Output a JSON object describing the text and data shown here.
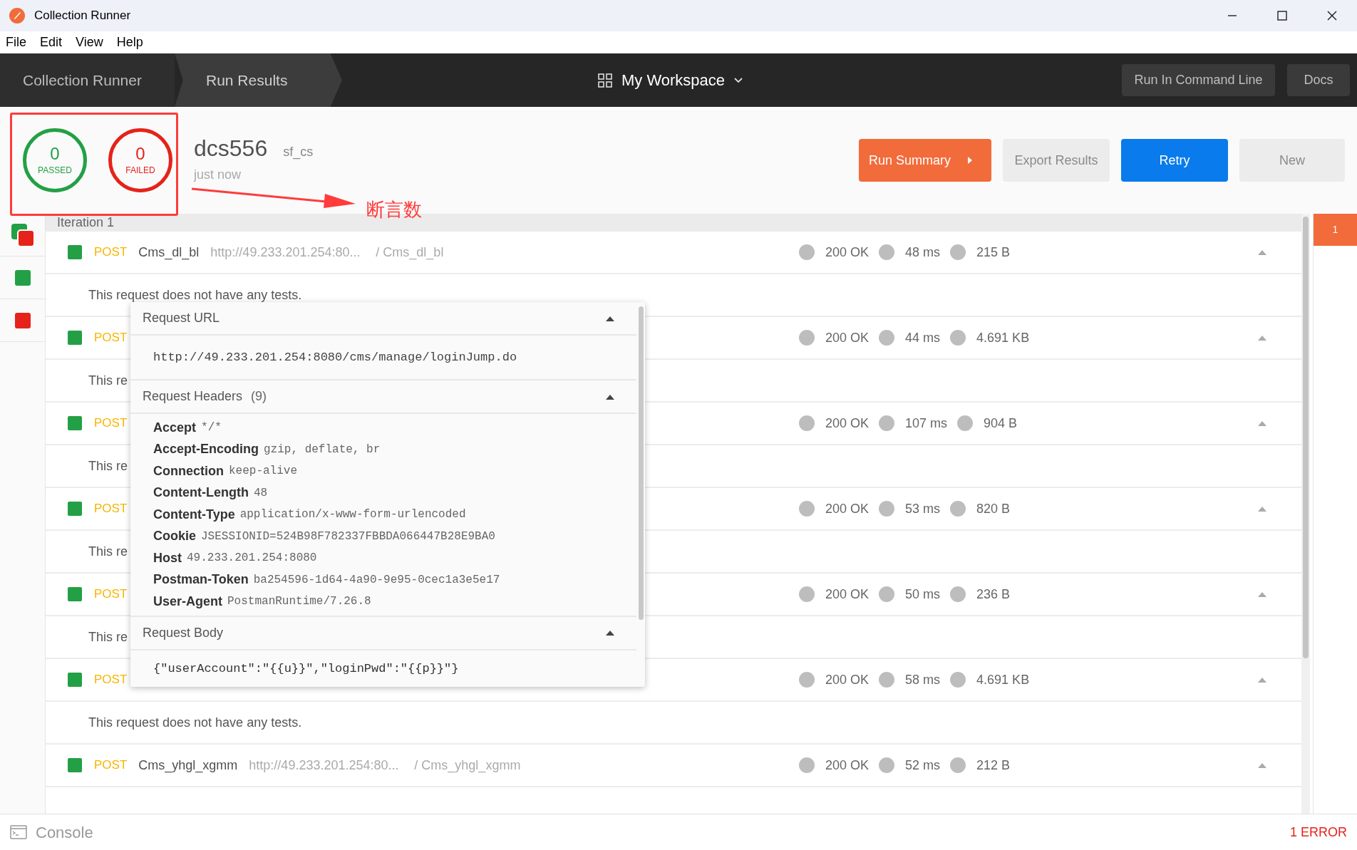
{
  "window": {
    "title": "Collection Runner"
  },
  "menu": [
    "File",
    "Edit",
    "View",
    "Help"
  ],
  "nav": {
    "tabs": [
      {
        "label": "Collection Runner",
        "selected": false
      },
      {
        "label": "Run Results",
        "selected": true
      }
    ],
    "workspace": "My Workspace",
    "buttons": [
      "Run In Command Line",
      "Docs"
    ]
  },
  "summary": {
    "passed": {
      "count": "0",
      "label": "PASSED"
    },
    "failed": {
      "count": "0",
      "label": "FAILED"
    },
    "collection": "dcs556",
    "environment": "sf_cs",
    "time": "just now"
  },
  "annotation": {
    "text": "断言数"
  },
  "actions": [
    {
      "label": "Run Summary",
      "kind": "primary"
    },
    {
      "label": "Export Results",
      "kind": "secondary"
    },
    {
      "label": "Retry",
      "kind": "blue"
    },
    {
      "label": "New",
      "kind": "secondary"
    }
  ],
  "iterations": [
    {
      "kind": "mixed"
    },
    {
      "kind": "pass"
    },
    {
      "kind": "fail"
    }
  ],
  "iteration_label": "Iteration 1",
  "requests": [
    {
      "method": "POST",
      "name": "Cms_dl_bl",
      "url": "http://49.233.201.254:80...",
      "path": "/ Cms_dl_bl",
      "status": "200 OK",
      "time": "48 ms",
      "size": "215 B",
      "test_note": "This request does not have any tests."
    },
    {
      "method": "POST",
      "status": "200 OK",
      "time": "44 ms",
      "size": "4.691 KB",
      "test_note": "This re"
    },
    {
      "method": "POST",
      "status": "200 OK",
      "time": "107 ms",
      "size": "904 B",
      "test_note": "This re"
    },
    {
      "method": "POST",
      "status": "200 OK",
      "time": "53 ms",
      "size": "820 B",
      "test_note": "This re"
    },
    {
      "method": "POST",
      "status": "200 OK",
      "time": "50 ms",
      "size": "236 B",
      "test_note": "This re"
    },
    {
      "method": "POST",
      "status": "200 OK",
      "time": "58 ms",
      "size": "4.691 KB",
      "test_note": "This request does not have any tests."
    },
    {
      "method": "POST",
      "name": "Cms_yhgl_xgmm",
      "url": "http://49.233.201.254:80...",
      "path": "/ Cms_yhgl_xgmm",
      "status": "200 OK",
      "time": "52 ms",
      "size": "212 B"
    }
  ],
  "right_panel": {
    "badge": "1"
  },
  "popup": {
    "url_title": "Request URL",
    "url": "http://49.233.201.254:8080/cms/manage/loginJump.do",
    "headers_title": "Request Headers",
    "headers_count": "(9)",
    "headers": [
      {
        "key": "Accept",
        "value": "*/*"
      },
      {
        "key": "Accept-Encoding",
        "value": "gzip, deflate, br"
      },
      {
        "key": "Connection",
        "value": "keep-alive"
      },
      {
        "key": "Content-Length",
        "value": "48"
      },
      {
        "key": "Content-Type",
        "value": "application/x-www-form-urlencoded"
      },
      {
        "key": "Cookie",
        "value": "JSESSIONID=524B98F782337FBBDA066447B28E9BA0"
      },
      {
        "key": "Host",
        "value": "49.233.201.254:8080"
      },
      {
        "key": "Postman-Token",
        "value": "ba254596-1d64-4a90-9e95-0cec1a3e5e17"
      },
      {
        "key": "User-Agent",
        "value": "PostmanRuntime/7.26.8"
      }
    ],
    "body_title": "Request Body",
    "body": "{\"userAccount\":\"{{u}}\",\"loginPwd\":\"{{p}}\"}"
  },
  "status_bar": {
    "console": "Console",
    "errors": "1 ERROR"
  }
}
